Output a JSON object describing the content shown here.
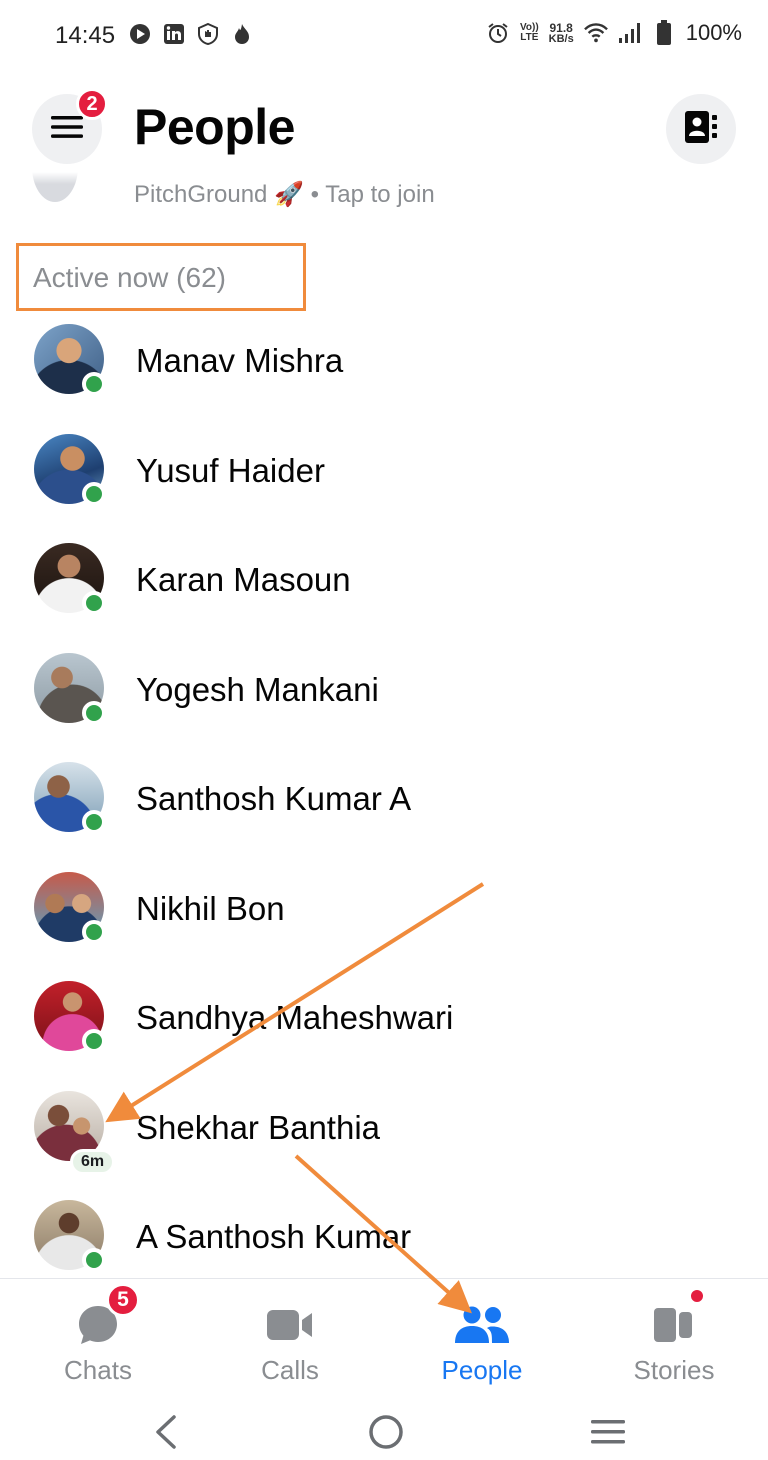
{
  "status_bar": {
    "time": "14:45",
    "left_icons": [
      "play-icon",
      "linkedin-icon",
      "shield-hand-icon",
      "flame-icon"
    ],
    "network_speed_value": "91.8",
    "network_speed_unit": "KB/s",
    "volte_label_top": "Vo))",
    "volte_label_bottom": "LTE",
    "battery": "100%"
  },
  "header": {
    "title": "People",
    "menu_badge": "2"
  },
  "partial_row": {
    "text": "PitchGround 🚀 • Tap to join"
  },
  "section": {
    "title": "Active now (62)"
  },
  "people": [
    {
      "name": "Manav Mishra",
      "status": "online"
    },
    {
      "name": "Yusuf Haider",
      "status": "online"
    },
    {
      "name": "Karan Masoun",
      "status": "online"
    },
    {
      "name": "Yogesh Mankani",
      "status": "online"
    },
    {
      "name": "Santhosh Kumar A",
      "status": "online"
    },
    {
      "name": "Nikhil Bon",
      "status": "online"
    },
    {
      "name": "Sandhya Maheshwari",
      "status": "online"
    },
    {
      "name": "Shekhar Banthia",
      "status": "recent",
      "last_active": "6m"
    },
    {
      "name": "A Santhosh Kumar",
      "status": "online"
    }
  ],
  "tabs": [
    {
      "label": "Chats",
      "icon": "chat-bubble-icon",
      "badge": "5"
    },
    {
      "label": "Calls",
      "icon": "video-camera-icon"
    },
    {
      "label": "People",
      "icon": "people-icon",
      "active": true
    },
    {
      "label": "Stories",
      "icon": "stories-icon",
      "dot": true
    }
  ],
  "colors": {
    "accent": "#1877f2",
    "online": "#31a24c",
    "badge": "#e41e3f",
    "annotation": "#f08b3c",
    "muted_text": "#8a8d91"
  }
}
